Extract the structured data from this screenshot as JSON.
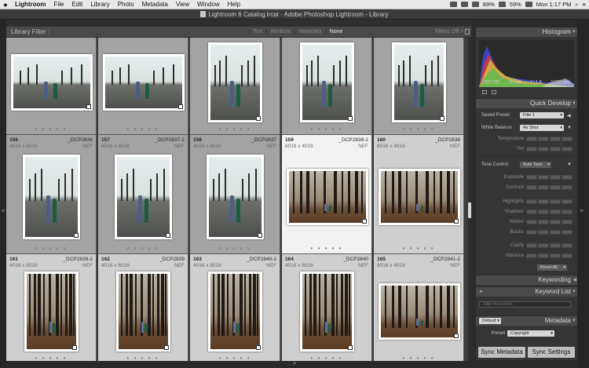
{
  "menubar": {
    "app": "Lightroom",
    "items": [
      "File",
      "Edit",
      "Library",
      "Photo",
      "Metadata",
      "View",
      "Window",
      "Help"
    ],
    "battery": "89%",
    "wifi_pct": "59%",
    "clock": "Mon 1:17 PM"
  },
  "window": {
    "title": "Lightroom 6 Catalog.lrcat - Adobe Photoshop Lightroom - Library"
  },
  "filter": {
    "title": "Library Filter :",
    "tabs": [
      "Text",
      "Attribute",
      "Metadata",
      "None"
    ],
    "active_tab": "None",
    "filters_off": "Filters Off ÷"
  },
  "grid": {
    "rows": [
      {
        "cells": [
          {
            "index": "",
            "filename": "",
            "dims": "",
            "ext": "",
            "kind": "road",
            "orient": "landscape",
            "shade": "gray"
          },
          {
            "index": "",
            "filename": "",
            "dims": "",
            "ext": "",
            "kind": "road",
            "orient": "landscape",
            "shade": "gray"
          },
          {
            "index": "",
            "filename": "",
            "dims": "",
            "ext": "",
            "kind": "road",
            "orient": "portrait",
            "shade": "gray"
          },
          {
            "index": "",
            "filename": "",
            "dims": "",
            "ext": "",
            "kind": "road",
            "orient": "portrait",
            "shade": "gray"
          },
          {
            "index": "",
            "filename": "",
            "dims": "",
            "ext": "",
            "kind": "road",
            "orient": "portrait",
            "shade": "gray"
          }
        ]
      },
      {
        "cells": [
          {
            "index": "156",
            "filename": "_DCP2836",
            "dims": "4016 x 6016",
            "ext": "NEF",
            "kind": "road",
            "orient": "portrait",
            "shade": "gray"
          },
          {
            "index": "157",
            "filename": "_DCP2837-2",
            "dims": "4016 x 6016",
            "ext": "NEF",
            "kind": "road",
            "orient": "portrait",
            "shade": "gray"
          },
          {
            "index": "158",
            "filename": "_DCP2837",
            "dims": "4016 x 6016",
            "ext": "NEF",
            "kind": "road",
            "orient": "portrait",
            "shade": "gray"
          },
          {
            "index": "159",
            "filename": "_DCP2838-2",
            "dims": "6016 x 4016",
            "ext": "NEF",
            "kind": "forest",
            "orient": "landscape",
            "shade": "sel"
          },
          {
            "index": "160",
            "filename": "_DCP2838",
            "dims": "6016 x 4016",
            "ext": "NEF",
            "kind": "forest",
            "orient": "landscape",
            "shade": "light"
          }
        ]
      },
      {
        "cells": [
          {
            "index": "161",
            "filename": "_DCP2839-2",
            "dims": "4016 x 6016",
            "ext": "NEF",
            "kind": "forest",
            "orient": "portrait",
            "shade": "light"
          },
          {
            "index": "162",
            "filename": "_DCP2839",
            "dims": "4016 x 6016",
            "ext": "NEF",
            "kind": "forest",
            "orient": "portrait",
            "shade": "light"
          },
          {
            "index": "163",
            "filename": "_DCP2840-2",
            "dims": "4016 x 6016",
            "ext": "NEF",
            "kind": "forest",
            "orient": "portrait",
            "shade": "light"
          },
          {
            "index": "164",
            "filename": "_DCP2840",
            "dims": "4016 x 6016",
            "ext": "NEF",
            "kind": "forest",
            "orient": "portrait",
            "shade": "light"
          },
          {
            "index": "165",
            "filename": "_DCP2841-2",
            "dims": "6016 x 4016",
            "ext": "NEF",
            "kind": "forest",
            "orient": "landscape",
            "shade": "light"
          }
        ]
      }
    ]
  },
  "panel": {
    "histogram": {
      "title": "Histogram",
      "iso": "ISO 320",
      "focal": "20 mm",
      "aperture": "f / 1.8",
      "shutter": "1/320 sec"
    },
    "quick_develop": {
      "title": "Quick Develop",
      "saved_preset_label": "Saved Preset",
      "saved_preset_value": "Film 1",
      "white_balance_label": "White Balance",
      "white_balance_value": "As Shot",
      "temperature": "Temperature",
      "tint": "Tint",
      "tone_control": "Tone Control",
      "auto_tone": "Auto Tone",
      "exposure": "Exposure",
      "contrast": "Contrast",
      "highlights": "Highlights",
      "shadows": "Shadows",
      "whites": "Whites",
      "blacks": "Blacks",
      "clarity": "Clarity",
      "vibrance": "Vibrance",
      "reset_all": "Reset All"
    },
    "keywording": "Keywording",
    "keyword_list": "Keyword List",
    "keyword_filter_placeholder": "Filter Keywords",
    "metadata_title": "Metadata",
    "metadata_preset_select": "Default",
    "preset_label": "Preset",
    "preset_value": "Copyright",
    "sync_metadata": "Sync Metadata",
    "sync_settings": "Sync Settings"
  }
}
